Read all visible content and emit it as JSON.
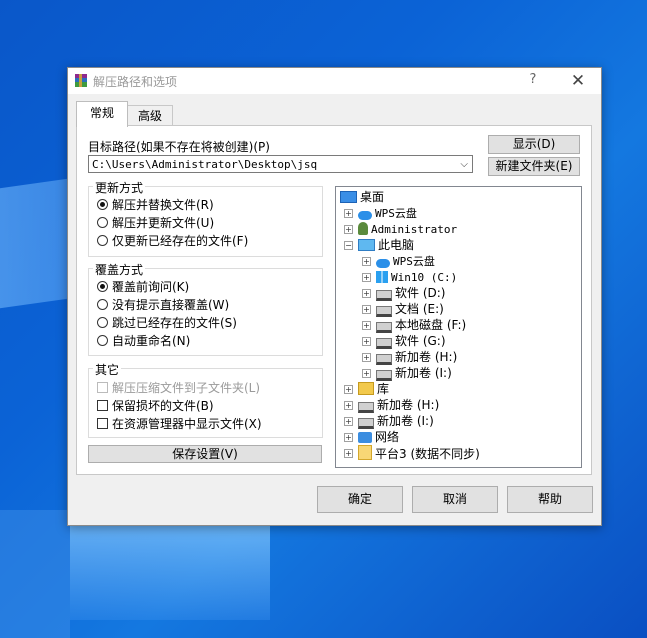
{
  "window": {
    "title": "解压路径和选项",
    "help_glyph": "?",
    "close_glyph": "✕"
  },
  "tabs": [
    "常规",
    "高级"
  ],
  "destination": {
    "label": "目标路径(如果不存在将被创建)(P)",
    "value": "C:\\Users\\Administrator\\Desktop\\jsq",
    "dropdown_glyph": "⌵"
  },
  "buttons": {
    "show": "显示(D)",
    "new_folder": "新建文件夹(E)",
    "save_settings": "保存设置(V)",
    "ok": "确定",
    "cancel": "取消",
    "help": "帮助"
  },
  "update_mode": {
    "title": "更新方式",
    "options": [
      {
        "label": "解压并替换文件(R)",
        "selected": true
      },
      {
        "label": "解压并更新文件(U)",
        "selected": false
      },
      {
        "label": "仅更新已经存在的文件(F)",
        "selected": false
      }
    ]
  },
  "overwrite_mode": {
    "title": "覆盖方式",
    "options": [
      {
        "label": "覆盖前询问(K)",
        "selected": true
      },
      {
        "label": "没有提示直接覆盖(W)",
        "selected": false
      },
      {
        "label": "跳过已经存在的文件(S)",
        "selected": false
      },
      {
        "label": "自动重命名(N)",
        "selected": false
      }
    ]
  },
  "misc": {
    "title": "其它",
    "options": [
      {
        "label": "解压压缩文件到子文件夹(L)",
        "checked": false,
        "disabled": true
      },
      {
        "label": "保留损坏的文件(B)",
        "checked": false,
        "disabled": false
      },
      {
        "label": "在资源管理器中显示文件(X)",
        "checked": false,
        "disabled": false
      }
    ]
  },
  "tree": {
    "root": "桌面",
    "items": [
      {
        "label": "WPS云盘",
        "icon": "cloud-icon",
        "level": 1,
        "expander": "+"
      },
      {
        "label": "Administrator",
        "icon": "user-icon",
        "level": 1,
        "expander": "+"
      },
      {
        "label": "此电脑",
        "icon": "computer-icon",
        "level": 1,
        "expander": "−"
      },
      {
        "label": "WPS云盘",
        "icon": "cloud-icon",
        "level": 2,
        "expander": "+"
      },
      {
        "label": "Win10 (C:)",
        "icon": "windows-drive-icon",
        "level": 2,
        "expander": "+"
      },
      {
        "label": "软件 (D:)",
        "icon": "drive-icon",
        "level": 2,
        "expander": "+"
      },
      {
        "label": "文档 (E:)",
        "icon": "drive-icon",
        "level": 2,
        "expander": "+"
      },
      {
        "label": "本地磁盘 (F:)",
        "icon": "drive-icon",
        "level": 2,
        "expander": "+"
      },
      {
        "label": "软件 (G:)",
        "icon": "drive-icon",
        "level": 2,
        "expander": "+"
      },
      {
        "label": "新加卷 (H:)",
        "icon": "drive-icon",
        "level": 2,
        "expander": "+"
      },
      {
        "label": "新加卷 (I:)",
        "icon": "drive-icon",
        "level": 2,
        "expander": "+"
      },
      {
        "label": "库",
        "icon": "library-icon",
        "level": 1,
        "expander": "+"
      },
      {
        "label": "新加卷 (H:)",
        "icon": "drive-icon",
        "level": 1,
        "expander": "+"
      },
      {
        "label": "新加卷 (I:)",
        "icon": "drive-icon",
        "level": 1,
        "expander": "+"
      },
      {
        "label": "网络",
        "icon": "network-icon",
        "level": 1,
        "expander": "+"
      },
      {
        "label": "平台3 (数据不同步)",
        "icon": "folder-icon",
        "level": 1,
        "expander": "+"
      }
    ]
  }
}
